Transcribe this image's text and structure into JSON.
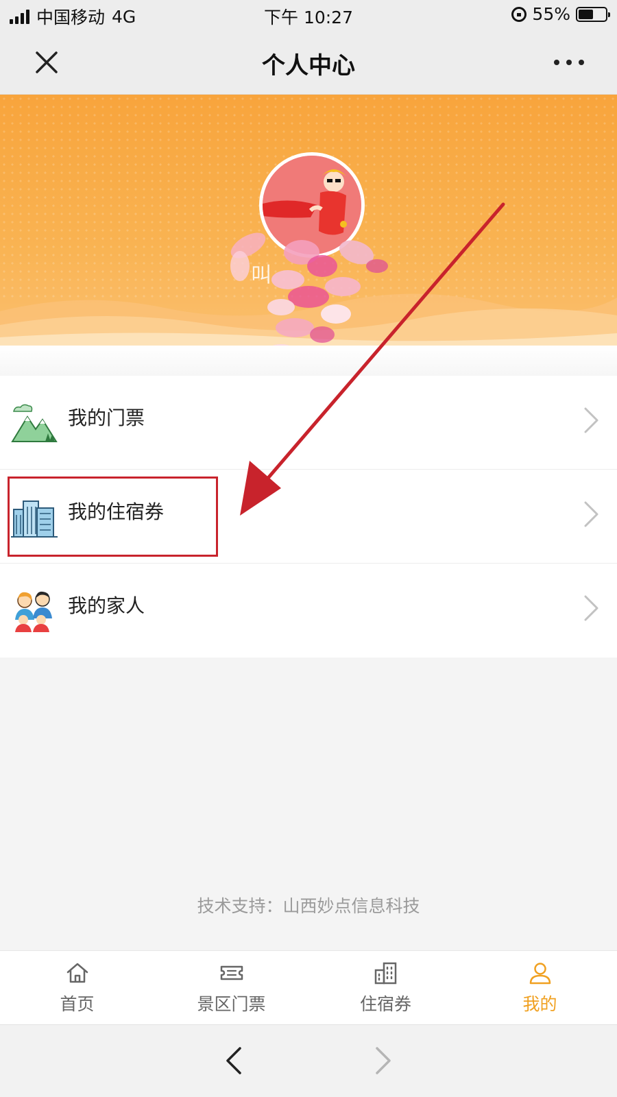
{
  "status_bar": {
    "carrier": "中国移动",
    "network": "4G",
    "time": "下午 10:27",
    "battery_percent": "55%",
    "battery_level": 0.55
  },
  "nav": {
    "title": "个人中心",
    "close_icon": "close-icon",
    "more_icon": "more-dots-icon"
  },
  "profile": {
    "username_visible_fragment": "叫"
  },
  "menu": {
    "items": [
      {
        "label": "我的门票",
        "icon": "mountain-ticket-icon"
      },
      {
        "label": "我的住宿券",
        "icon": "buildings-hotel-icon"
      },
      {
        "label": "我的家人",
        "icon": "family-icon"
      }
    ]
  },
  "footer": {
    "credit": "技术支持：山西妙点信息科技"
  },
  "tabbar": {
    "items": [
      {
        "label": "首页",
        "icon": "home-icon",
        "active": false
      },
      {
        "label": "景区门票",
        "icon": "ticket-icon",
        "active": false
      },
      {
        "label": "住宿券",
        "icon": "building-icon",
        "active": false
      },
      {
        "label": "我的",
        "icon": "user-icon",
        "active": true
      }
    ]
  },
  "colors": {
    "accent": "#f0a020",
    "banner_top": "#f8a43c",
    "annotation_red": "#c8232c"
  }
}
